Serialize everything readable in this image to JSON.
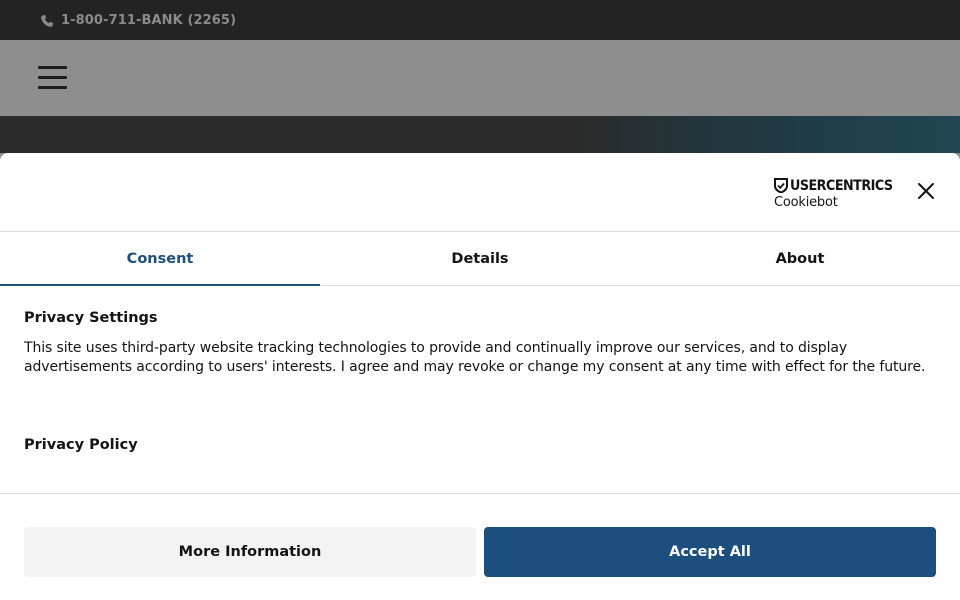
{
  "topbar": {
    "phone_icon": "phone-icon",
    "phone_text": "1-800-711-BANK (2265)"
  },
  "header": {
    "menu_icon": "hamburger-menu-icon"
  },
  "dialog": {
    "brand": {
      "name": "USERCENTRICS",
      "sub": "Cookiebot",
      "icon": "shield-check-icon"
    },
    "close_icon": "close-icon",
    "tabs": [
      {
        "label": "Consent",
        "active": true
      },
      {
        "label": "Details",
        "active": false
      },
      {
        "label": "About",
        "active": false
      }
    ],
    "section_title": "Privacy Settings",
    "body_text": "This site uses third-party website tracking technologies to provide and continually improve our services, and to display advertisements according to users' interests. I agree and may revoke or change my consent at any time with effect for the future.",
    "policy_link": "Privacy Policy",
    "buttons": {
      "more": "More Information",
      "accept": "Accept All"
    }
  },
  "colors": {
    "accent": "#1d4f7e",
    "topbar": "#232323",
    "overlay": "#8e8e8e"
  }
}
